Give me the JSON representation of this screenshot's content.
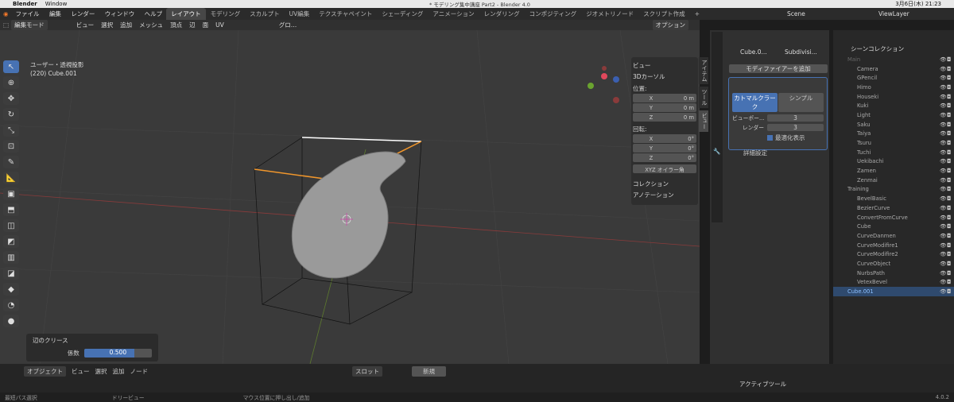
{
  "mac": {
    "apple": "",
    "app": "Blender",
    "window": "Window",
    "date": "3月6日(木) 21:23"
  },
  "title": "* モデリング集中講座 Part2 - Blender 4.0",
  "menus": [
    "ファイル",
    "編集",
    "レンダー",
    "ウィンドウ",
    "ヘルプ"
  ],
  "workspaces": [
    "レイアウト",
    "モデリング",
    "スカルプト",
    "UV編集",
    "テクスチャペイント",
    "シェーディング",
    "アニメーション",
    "レンダリング",
    "コンポジティング",
    "ジオメトリノード",
    "スクリプト作成"
  ],
  "active_ws": "レイアウト",
  "scene": "Scene",
  "viewlayer": "ViewLayer",
  "vpheader": {
    "mode": "編集モード",
    "items": [
      "ビュー",
      "選択",
      "追加",
      "メッシュ",
      "頂点",
      "辺",
      "面",
      "UV"
    ],
    "transform": "グロ…",
    "options": "オプション"
  },
  "viewport": {
    "view_name": "ユーザー・透視投影",
    "object": "(220) Cube.001",
    "axes": [
      "X",
      "Y",
      "Z"
    ]
  },
  "npanel": {
    "view": "ビュー",
    "cursor": "3Dカーソル",
    "location": "位置:",
    "loc": [
      {
        "a": "X",
        "v": "0 m"
      },
      {
        "a": "Y",
        "v": "0 m"
      },
      {
        "a": "Z",
        "v": "0 m"
      }
    ],
    "rotation": "回転:",
    "rot": [
      {
        "a": "X",
        "v": "0°"
      },
      {
        "a": "Y",
        "v": "0°"
      },
      {
        "a": "Z",
        "v": "0°"
      }
    ],
    "euler": "XYZ オイラー角",
    "collection": "コレクション",
    "annotation": "アノテーション"
  },
  "vtabs": [
    "アイテム",
    "ツール",
    "ビュー"
  ],
  "props": {
    "object": "Cube.0...",
    "modifier": "Subdivisi...",
    "add": "モディファイアーを追加",
    "catmull": "カトマルクラーク",
    "simple": "シンプル",
    "vp_label": "ビューポー...",
    "vp_val": "3",
    "rd_label": "レンダー",
    "rd_val": "3",
    "optimal": "最適化表示",
    "advanced": "詳細設定"
  },
  "outliner": {
    "header": "シーンコレクション",
    "rows": [
      "Main",
      "Camera",
      "GPencil",
      "Himo",
      "Houseki",
      "Kuki",
      "Light",
      "Saku",
      "Taiya",
      "Tsuru",
      "Tuchi",
      "Uekibachi",
      "Zamen",
      "Zenmai",
      "Training",
      "BevelBasic",
      "BezierCurve",
      "ConvertFromCurve",
      "Cube",
      "CurveDanmen",
      "CurveModifire1",
      "CurveModifire2",
      "CurveObject",
      "NurbsPath",
      "VetexBevel",
      "Cube.001"
    ]
  },
  "redo": {
    "title": "辺のクリース",
    "label": "係数",
    "value": "0.500"
  },
  "timeline": {
    "mode": "オブジェクト",
    "items": [
      "ビュー",
      "選択",
      "追加",
      "ノード"
    ],
    "slot": "スロット",
    "new": "新規"
  },
  "activetool": "アクティブツール",
  "status": {
    "left": "最短パス選択",
    "mid": "ドリービュー",
    "right": "マウス位置に押し出し/追加",
    "version": "4.0.2"
  }
}
